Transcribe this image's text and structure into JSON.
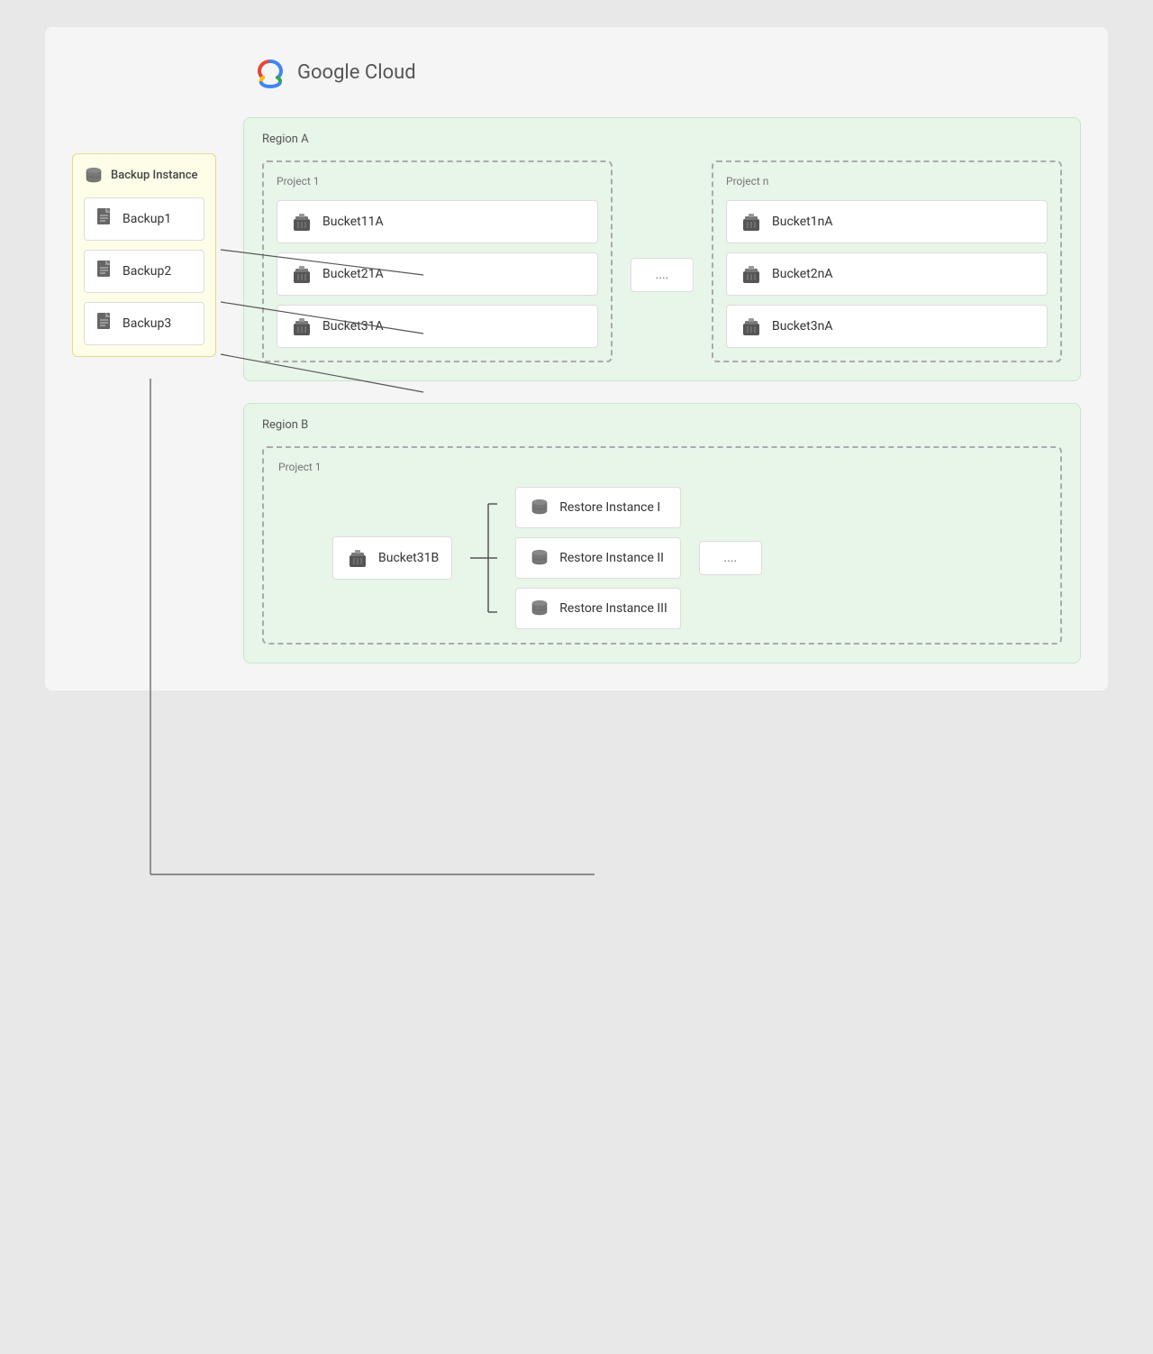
{
  "logo": {
    "text": "Google Cloud"
  },
  "backup_panel": {
    "title": "Backup Instance",
    "items": [
      {
        "label": "Backup1"
      },
      {
        "label": "Backup2"
      },
      {
        "label": "Backup3"
      }
    ]
  },
  "region_a": {
    "label": "Region A",
    "project1": {
      "label": "Project 1",
      "buckets": [
        {
          "label": "Bucket11A"
        },
        {
          "label": "Bucket21A"
        },
        {
          "label": "Bucket31A"
        }
      ]
    },
    "dots": "....",
    "projectN": {
      "label": "Project n",
      "buckets": [
        {
          "label": "Bucket1nA"
        },
        {
          "label": "Bucket2nA"
        },
        {
          "label": "Bucket3nA"
        }
      ]
    }
  },
  "region_b": {
    "label": "Region B",
    "project1": {
      "label": "Project 1",
      "bucket": {
        "label": "Bucket31B"
      },
      "restore_instances": [
        {
          "label": "Restore Instance I"
        },
        {
          "label": "Restore Instance II"
        },
        {
          "label": "Restore Instance III"
        }
      ],
      "dots": "...."
    }
  }
}
